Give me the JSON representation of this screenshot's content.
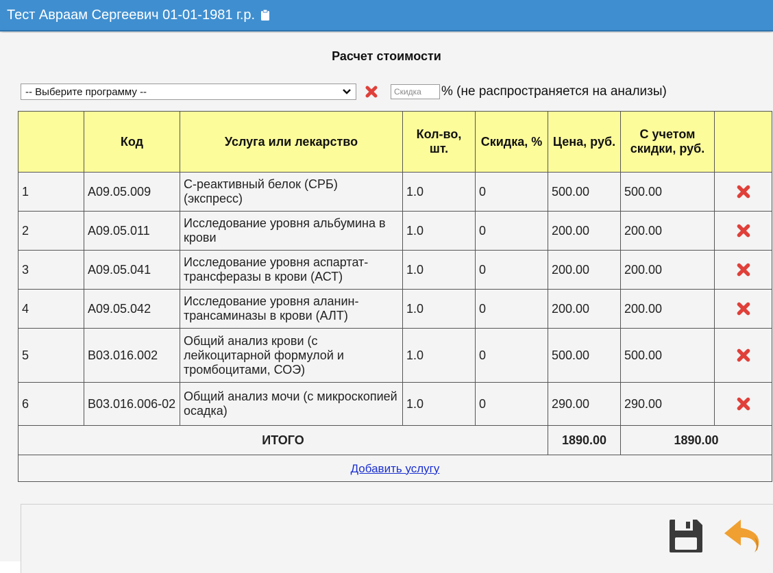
{
  "header": {
    "title": "Тест Авраам Сергеевич 01-01-1981 г.р.",
    "icon": "clipboard-icon"
  },
  "page": {
    "heading": "Расчет стоимости"
  },
  "controls": {
    "program_select_value": "-- Выберите программу --",
    "discount_placeholder": "Скидка",
    "discount_note": "% (не распространяется на анализы)"
  },
  "table": {
    "headers": [
      "",
      "Код",
      "Услуга или лекарство",
      "Кол-во, шт.",
      "Скидка, %",
      "Цена, руб.",
      "С учетом скидки, руб.",
      ""
    ],
    "rows": [
      {
        "n": "1",
        "code": "A09.05.009",
        "name": "С-реактивный белок (СРБ) (экспресс)",
        "qty": "1.0",
        "disc": "0",
        "price": "500.00",
        "total": "500.00"
      },
      {
        "n": "2",
        "code": "A09.05.011",
        "name": "Исследование уровня альбумина в крови",
        "qty": "1.0",
        "disc": "0",
        "price": "200.00",
        "total": "200.00"
      },
      {
        "n": "3",
        "code": "A09.05.041",
        "name": "Исследование уровня аспартат-трансферазы в крови (АСТ)",
        "qty": "1.0",
        "disc": "0",
        "price": "200.00",
        "total": "200.00"
      },
      {
        "n": "4",
        "code": "A09.05.042",
        "name": "Исследование уровня аланин-трансаминазы в крови (АЛТ)",
        "qty": "1.0",
        "disc": "0",
        "price": "200.00",
        "total": "200.00"
      },
      {
        "n": "5",
        "code": "B03.016.002",
        "name": "Общий анализ крови (с лейкоцитарной формулой и тромбоцитами, СОЭ)",
        "qty": "1.0",
        "disc": "0",
        "price": "500.00",
        "total": "500.00"
      },
      {
        "n": "6",
        "code": "B03.016.006-02",
        "name": "Общий анализ мочи (с микроскопией осадка)",
        "qty": "1.0",
        "disc": "0",
        "price": "290.00",
        "total": "290.00"
      }
    ],
    "total_label": "ИТОГО",
    "total_price": "1890.00",
    "total_discounted": "1890.00",
    "add_service_label": "Добавить услугу"
  },
  "footer": {
    "save_icon": "floppy-disk-icon",
    "back_icon": "undo-arrow-icon"
  },
  "colors": {
    "titlebar": "#3f8fd0",
    "header_row": "#fdfc9b",
    "delete_icon": "#e0403a",
    "back_icon": "#f0a030"
  }
}
